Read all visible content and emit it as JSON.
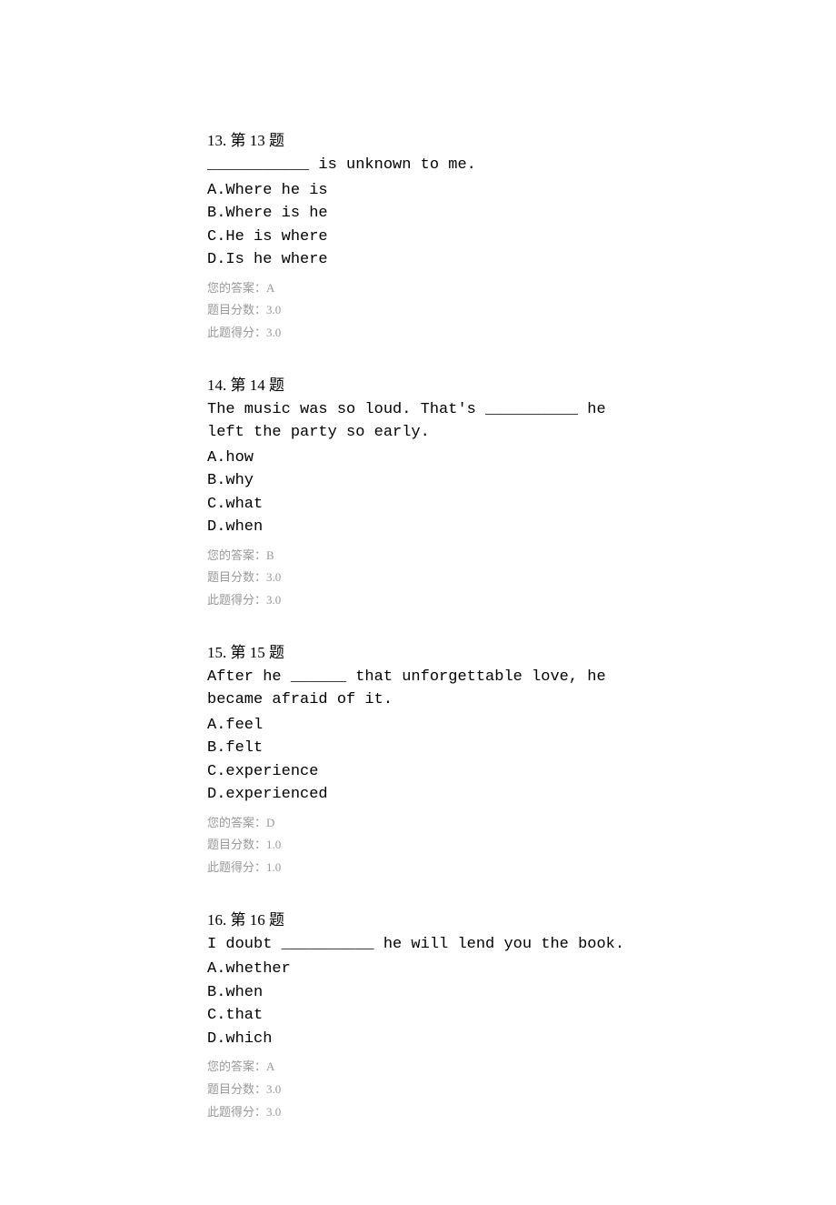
{
  "questions": [
    {
      "number": "13.  第 13 题",
      "text": "___________ is unknown to me.",
      "options": [
        "A.Where he is",
        "B.Where is he",
        "C.He is where",
        "D.Is he where"
      ],
      "answer_label": "您的答案：A",
      "score_label": "题目分数：3.0",
      "got_label": "此题得分：3.0"
    },
    {
      "number": "14.  第 14 题",
      "text": "The music was so loud. That's __________ he left the party so early.",
      "options": [
        "A.how",
        "B.why",
        "C.what",
        "D.when"
      ],
      "answer_label": "您的答案：B",
      "score_label": "题目分数：3.0",
      "got_label": "此题得分：3.0"
    },
    {
      "number": "15.  第 15 题",
      "text": "After he ______ that unforgettable love, he became afraid of it.",
      "options": [
        "A.feel",
        "B.felt",
        "C.experience",
        "D.experienced"
      ],
      "answer_label": "您的答案：D",
      "score_label": "题目分数：1.0",
      "got_label": "此题得分：1.0"
    },
    {
      "number": "16.  第 16 题",
      "text": "I doubt __________ he will lend you the book.",
      "options": [
        "A.whether",
        "B.when",
        "C.that",
        "D.which"
      ],
      "answer_label": "您的答案：A",
      "score_label": "题目分数：3.0",
      "got_label": "此题得分：3.0"
    }
  ]
}
